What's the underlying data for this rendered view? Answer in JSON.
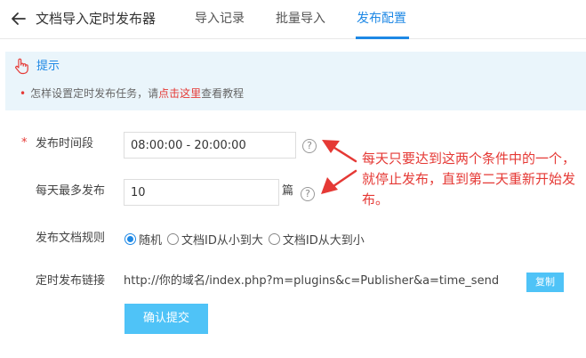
{
  "header": {
    "back_icon": "arrow-left-icon",
    "title": "文档导入定时发布器",
    "tabs": [
      {
        "label": "导入记录",
        "active": false
      },
      {
        "label": "批量导入",
        "active": false
      },
      {
        "label": "发布配置",
        "active": true
      }
    ]
  },
  "tip": {
    "icon": "hand-pointer-icon",
    "title": "提示",
    "line_prefix": "怎样设置定时发布任务，请",
    "link": "点击这里",
    "line_suffix": "查看教程"
  },
  "form": {
    "time_range": {
      "label": "发布时间段",
      "value": "08:00:00 - 20:00:00",
      "required": true
    },
    "daily_max": {
      "label": "每天最多发布",
      "value": "10",
      "unit": "篇"
    },
    "rule": {
      "label": "发布文档规则",
      "options": [
        {
          "label": "随机",
          "checked": true
        },
        {
          "label": "文档ID从小到大",
          "checked": false
        },
        {
          "label": "文档ID从大到小",
          "checked": false
        }
      ]
    },
    "link": {
      "label": "定时发布链接",
      "value": "http://你的域名/index.php?m=plugins&c=Publisher&a=time_send",
      "copy_label": "复制"
    },
    "submit_label": "确认提交",
    "help_glyph": "?"
  },
  "annotation": {
    "text": "每天只要达到这两个条件中的一个，就停止发布，直到第二天重新开始发布。",
    "color": "#e53935"
  },
  "colors": {
    "accent": "#1e88e5",
    "button": "#4fc3f7",
    "tip_bg": "#eaf5fb",
    "required": "#e53935"
  }
}
